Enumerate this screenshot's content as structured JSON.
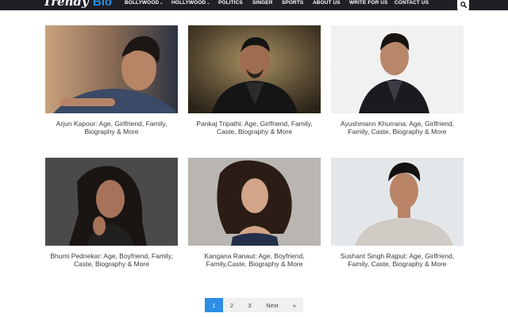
{
  "site": {
    "logo_main": "Trendy",
    "logo_accent": "Bio"
  },
  "nav": [
    {
      "label": "BOLLYWOOD",
      "caret": "⌄"
    },
    {
      "label": "HOLLYWOOD",
      "caret": "⌄"
    },
    {
      "label": "POLITICS"
    },
    {
      "label": "SINGER"
    },
    {
      "label": "SPORTS"
    },
    {
      "label": "ABOUT US"
    },
    {
      "label": "WRITE FOR US"
    },
    {
      "label": "CONTACT US"
    }
  ],
  "search": {
    "icon": "search-icon"
  },
  "articles": [
    {
      "line1": "Arjun Kapoor: Age, Girlfriend, Family,",
      "line2": "Biography & More"
    },
    {
      "line1": "Pankaj Tripathi: Age, Girlfriend, Family,",
      "line2": "Caste, Biography & More"
    },
    {
      "line1": "Ayushmann Khurrana: Age, Girlfriend,",
      "line2": "Family, Caste, Biography & More"
    },
    {
      "line1": "Bhumi Pednekar: Age, Boyfriend, Family,",
      "line2": "Caste, Biography & More"
    },
    {
      "line1": "Kangana Ranaut: Age, Boyfriend,",
      "line2": "Family,Caste, Biography & More"
    },
    {
      "line1": "Sushant Singh Rajput: Age, Girlfriend,",
      "line2": "Family, Caste, Biography & More"
    }
  ],
  "pagination": {
    "pages": [
      "1",
      "2",
      "3"
    ],
    "current": "1",
    "next": "Next",
    "last": "»"
  },
  "colors": {
    "header_bg": "#1f2025",
    "accent": "#2e8ee6",
    "text": "#3a3a3a"
  }
}
